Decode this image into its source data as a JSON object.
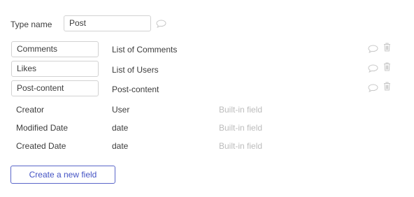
{
  "type_name": {
    "label": "Type name",
    "value": "Post"
  },
  "editable_fields": [
    {
      "name": "Comments",
      "type": "List of Comments"
    },
    {
      "name": "Likes",
      "type": "List of Users"
    },
    {
      "name": "Post-content",
      "type": "Post-content"
    }
  ],
  "builtin_fields": [
    {
      "name": "Creator",
      "type": "User",
      "note": "Built-in field"
    },
    {
      "name": "Modified Date",
      "type": "date",
      "note": "Built-in field"
    },
    {
      "name": "Created Date",
      "type": "date",
      "note": "Built-in field"
    }
  ],
  "create_button_label": "Create a new field",
  "icons": {
    "comment": "comment-bubble-icon",
    "delete": "trash-icon"
  },
  "colors": {
    "accent": "#4352c4",
    "muted": "#bcbcbc",
    "border": "#d2d2d2"
  }
}
